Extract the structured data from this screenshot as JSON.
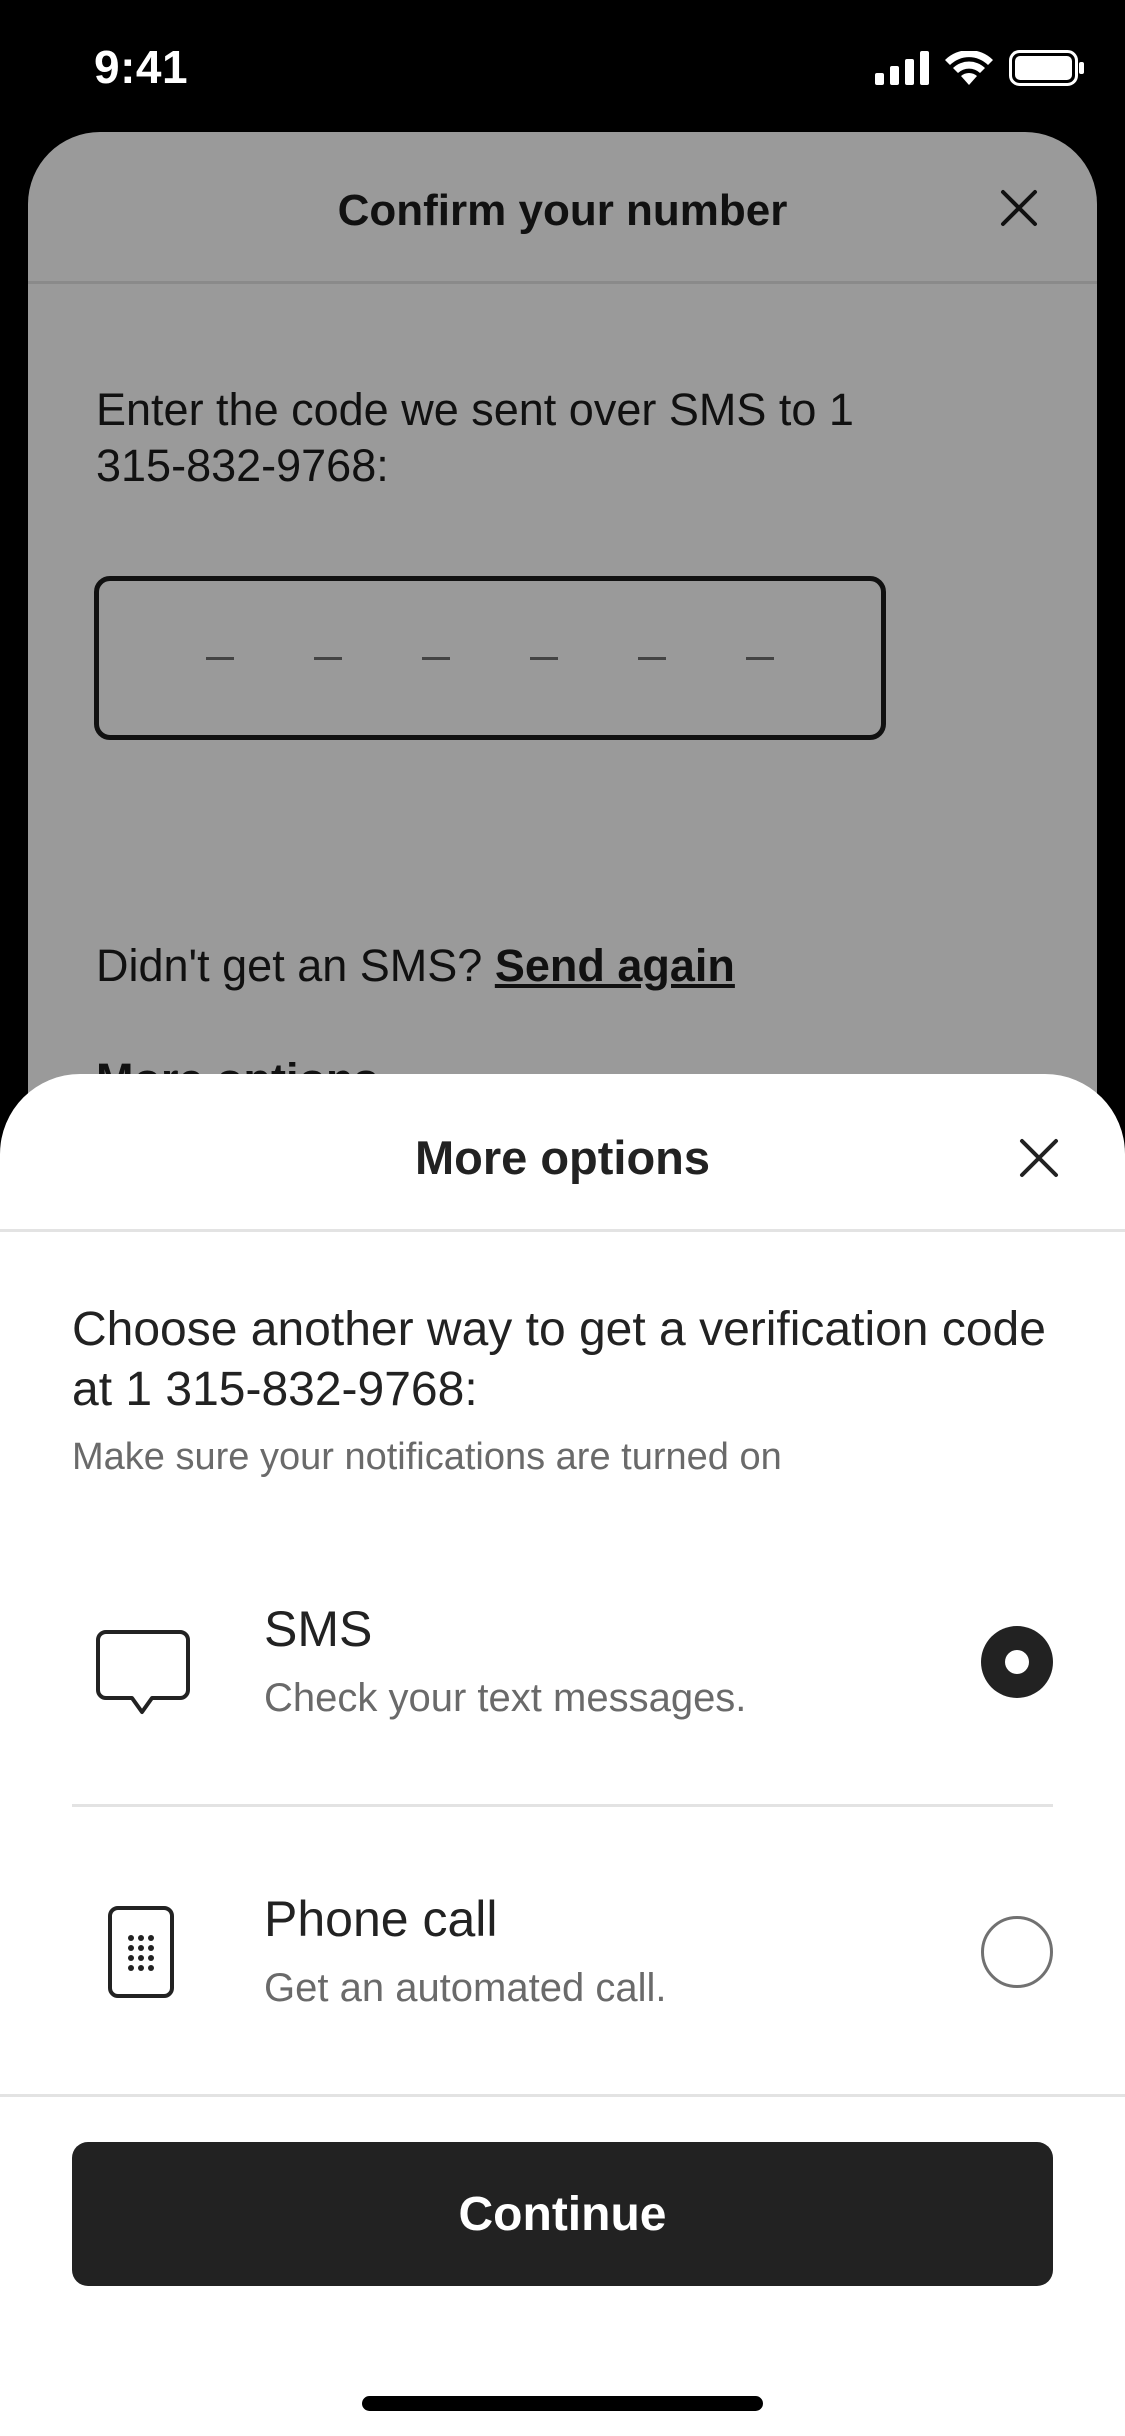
{
  "status_bar": {
    "time": "9:41"
  },
  "background": {
    "title": "Confirm your number",
    "instruction": "Enter the code we sent over SMS to 1 315-832-9768:",
    "resend_prompt": "Didn't get an SMS?",
    "resend_link": "Send again",
    "more_options_link": "More options"
  },
  "sheet": {
    "title": "More options",
    "description": "Choose another way to get a verification code at 1 315-832-9768:",
    "subtext": "Make sure your notifications are turned on",
    "options": [
      {
        "title": "SMS",
        "subtitle": "Check your text messages.",
        "icon": "chat-bubble-icon",
        "selected": true
      },
      {
        "title": "Phone call",
        "subtitle": "Get an automated call.",
        "icon": "phone-keypad-icon",
        "selected": false
      }
    ],
    "continue_label": "Continue"
  }
}
